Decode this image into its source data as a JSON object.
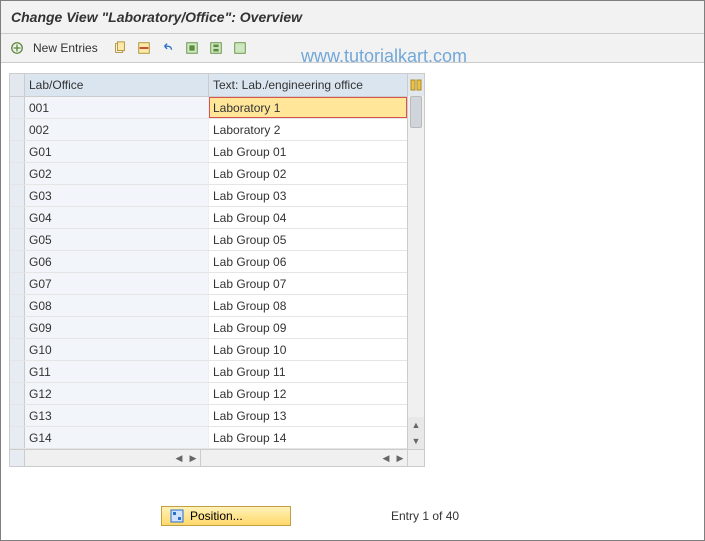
{
  "title": "Change View \"Laboratory/Office\": Overview",
  "watermark": "www.tutorialkart.com",
  "toolbar": {
    "new_entries": "New Entries"
  },
  "grid": {
    "headers": {
      "col1": "Lab/Office",
      "col2": "Text: Lab./engineering office"
    },
    "rows": [
      {
        "code": "001",
        "text": "Laboratory 1",
        "selected": true
      },
      {
        "code": "002",
        "text": "Laboratory 2"
      },
      {
        "code": "G01",
        "text": "Lab Group 01"
      },
      {
        "code": "G02",
        "text": "Lab Group 02"
      },
      {
        "code": "G03",
        "text": "Lab Group 03"
      },
      {
        "code": "G04",
        "text": "Lab Group 04"
      },
      {
        "code": "G05",
        "text": "Lab Group 05"
      },
      {
        "code": "G06",
        "text": "Lab Group 06"
      },
      {
        "code": "G07",
        "text": "Lab Group 07"
      },
      {
        "code": "G08",
        "text": "Lab Group 08"
      },
      {
        "code": "G09",
        "text": "Lab Group 09"
      },
      {
        "code": "G10",
        "text": "Lab Group 10"
      },
      {
        "code": "G11",
        "text": "Lab Group 11"
      },
      {
        "code": "G12",
        "text": "Lab Group 12"
      },
      {
        "code": "G13",
        "text": "Lab Group 13"
      },
      {
        "code": "G14",
        "text": "Lab Group 14"
      }
    ]
  },
  "footer": {
    "position_btn": "Position...",
    "entry_text": "Entry 1 of 40"
  }
}
